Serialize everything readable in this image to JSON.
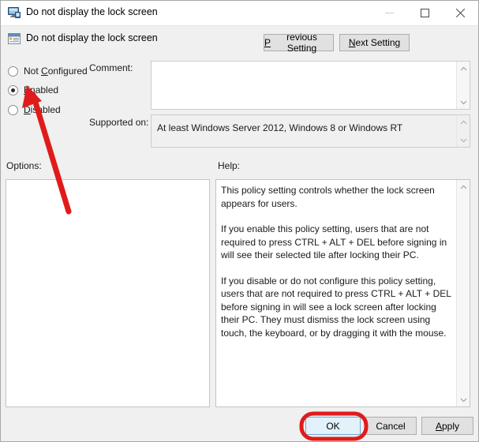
{
  "window": {
    "title": "Do not display the lock screen",
    "title_icon": "monitor-icon",
    "minimize_label": "Minimize",
    "maximize_label": "Maximize",
    "close_label": "Close"
  },
  "header": {
    "policy_icon": "policy-setting-icon",
    "policy_name": "Do not display the lock screen",
    "previous_setting": {
      "prefix": "",
      "accesskey": "P",
      "suffix": "revious Setting"
    },
    "next_setting": {
      "prefix": "",
      "accesskey": "N",
      "suffix": "ext Setting"
    }
  },
  "state_options": {
    "items": [
      {
        "prefix": "Not ",
        "accesskey": "C",
        "suffix": "onfigured",
        "selected": false
      },
      {
        "prefix": "",
        "accesskey": "E",
        "suffix": "nabled",
        "selected": true
      },
      {
        "prefix": "",
        "accesskey": "D",
        "suffix": "isabled",
        "selected": false
      }
    ]
  },
  "comment": {
    "label": "Comment:",
    "value": "",
    "scroll_up_icon": "chevron-up-icon",
    "scroll_down_icon": "chevron-down-icon"
  },
  "supported_on": {
    "label": "Supported on:",
    "value": "At least Windows Server 2012, Windows 8 or Windows RT",
    "scroll_up_icon": "chevron-up-icon",
    "scroll_down_icon": "chevron-down-icon"
  },
  "options_pane": {
    "label": "Options:",
    "content": ""
  },
  "help_pane": {
    "label": "Help:",
    "paragraphs": [
      "This policy setting controls whether the lock screen appears for users.",
      "If you enable this policy setting, users that are not required to press CTRL + ALT + DEL before signing in will see their selected tile after locking their PC.",
      "If you disable or do not configure this policy setting, users that are not required to press CTRL + ALT + DEL before signing in will see a lock screen after locking their PC. They must dismiss the lock screen using touch, the keyboard, or by dragging it with the mouse."
    ],
    "scroll_up_icon": "chevron-up-icon",
    "scroll_down_icon": "chevron-down-icon"
  },
  "footer": {
    "ok_label": "OK",
    "cancel_label": "Cancel",
    "apply": {
      "prefix": "",
      "accesskey": "A",
      "suffix": "pply"
    }
  },
  "annotations": {
    "arrow_color": "#e01b1b",
    "highlight_color": "#e01b1b",
    "arrow_target": "enabled-radio",
    "highlight_target": "ok-button"
  }
}
